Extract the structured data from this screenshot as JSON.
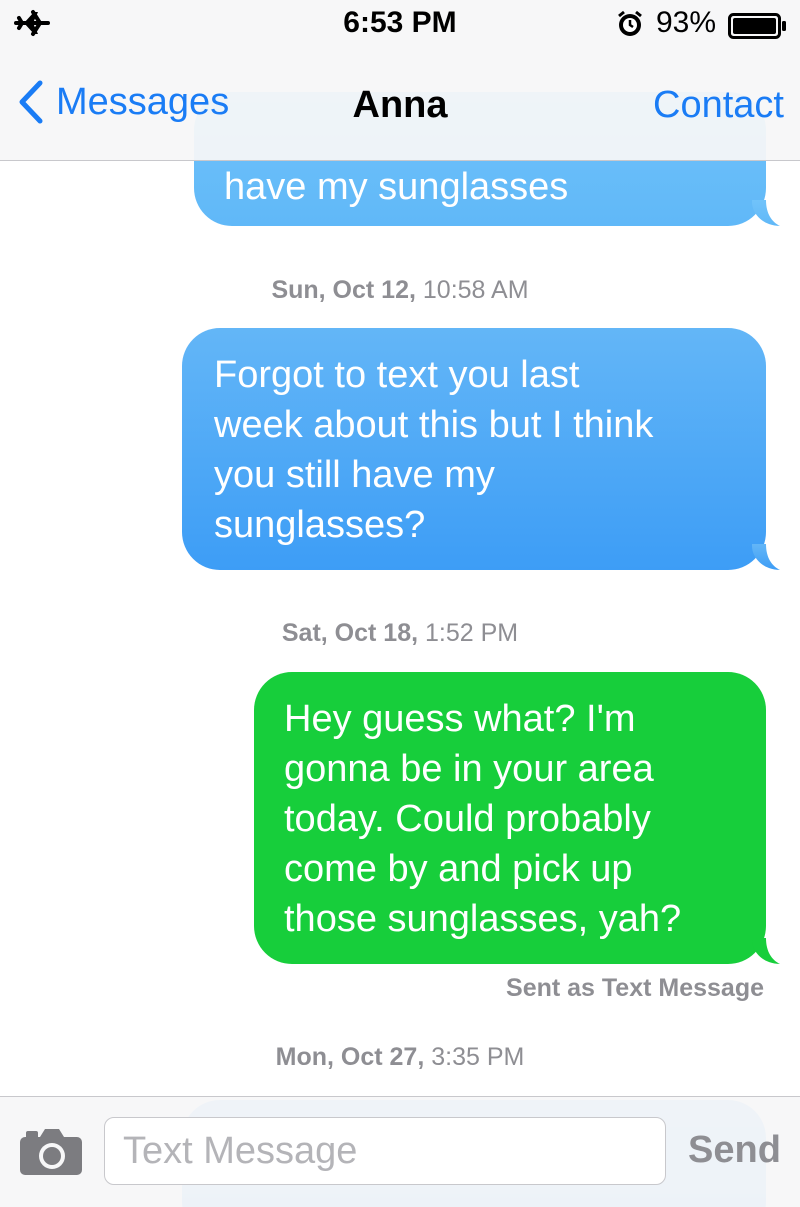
{
  "status_bar": {
    "time": "6:53 PM",
    "battery_percent": "93%",
    "icons": [
      "airplane-icon",
      "alarm-icon",
      "battery-icon"
    ]
  },
  "nav": {
    "back_label": "Messages",
    "title": "Anna",
    "contact_label": "Contact"
  },
  "thread": {
    "messages": [
      {
        "kind": "imessage",
        "text": "have my sunglasses"
      },
      {
        "kind": "timestamp",
        "day": "Sun, Oct 12,",
        "time": "10:58 AM"
      },
      {
        "kind": "imessage",
        "text": "Forgot to text you last\nweek about this but I think\nyou still have my\nsunglasses?"
      },
      {
        "kind": "timestamp",
        "day": "Sat, Oct 18,",
        "time": "1:52 PM"
      },
      {
        "kind": "sms",
        "text": "Hey guess what? I'm\ngonna be in your area\ntoday. Could probably\ncome by and pick up\nthose sunglasses, yah?"
      },
      {
        "kind": "delivery_note",
        "text": "Sent as Text Message"
      },
      {
        "kind": "timestamp",
        "day": "Mon, Oct 27,",
        "time": "3:35 PM"
      }
    ]
  },
  "input_bar": {
    "placeholder": "Text Message",
    "send_label": "Send"
  },
  "colors": {
    "ios_blue": "#1a7cf5",
    "imessage_bubble": "#3d9df6",
    "sms_bubble": "#17ce3b",
    "timestamp_gray": "#8e8e93"
  }
}
